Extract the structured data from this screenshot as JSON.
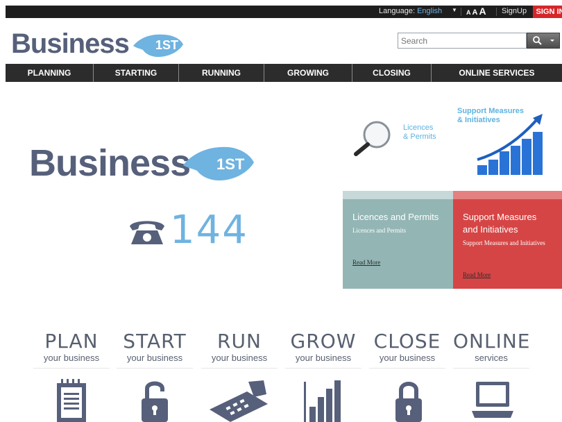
{
  "topbar": {
    "language_label": "Language:",
    "language_value": "English",
    "font_sizes": [
      "A",
      "A",
      "A"
    ],
    "signup": "SignUp",
    "signin": "SIGN IN"
  },
  "header": {
    "logo_text": "Business",
    "logo_badge": "1ST",
    "search_placeholder": "Search"
  },
  "nav": {
    "items": [
      {
        "label": "PLANNING"
      },
      {
        "label": "STARTING"
      },
      {
        "label": "RUNNING"
      },
      {
        "label": "GROWING"
      },
      {
        "label": "CLOSING"
      },
      {
        "label": "ONLINE SERVICES"
      }
    ]
  },
  "hero": {
    "logo_text": "Business",
    "logo_badge": "1ST",
    "phone_number": "144"
  },
  "promos": {
    "licences_image_text": [
      "Licences",
      "& Permits"
    ],
    "support_image_text": [
      "Support Measures",
      "& Initiatives"
    ]
  },
  "panels": [
    {
      "title": "Licences and Permits",
      "description": "Licences and Permits",
      "more": "Read More",
      "color": "#93b6b5"
    },
    {
      "title": "Support Measures and Initiatives",
      "description": "Support Measures and Initiatives",
      "more": "Read More",
      "color": "#d64545"
    }
  ],
  "categories": [
    {
      "title": "PLAN",
      "sub": "your business",
      "icon": "notepad-icon"
    },
    {
      "title": "START",
      "sub": "your business",
      "icon": "open-lock-icon"
    },
    {
      "title": "RUN",
      "sub": "your business",
      "icon": "calculator-icon"
    },
    {
      "title": "GROW",
      "sub": "your business",
      "icon": "bar-chart-icon"
    },
    {
      "title": "CLOSE",
      "sub": "your business",
      "icon": "closed-lock-icon"
    },
    {
      "title": "ONLINE",
      "sub": "services",
      "icon": "laptop-icon"
    }
  ],
  "colors": {
    "brand_slate": "#56607a",
    "brand_blue": "#6fb3e0",
    "signin_red": "#d6262a",
    "nav_dark": "#2c2c2c"
  }
}
